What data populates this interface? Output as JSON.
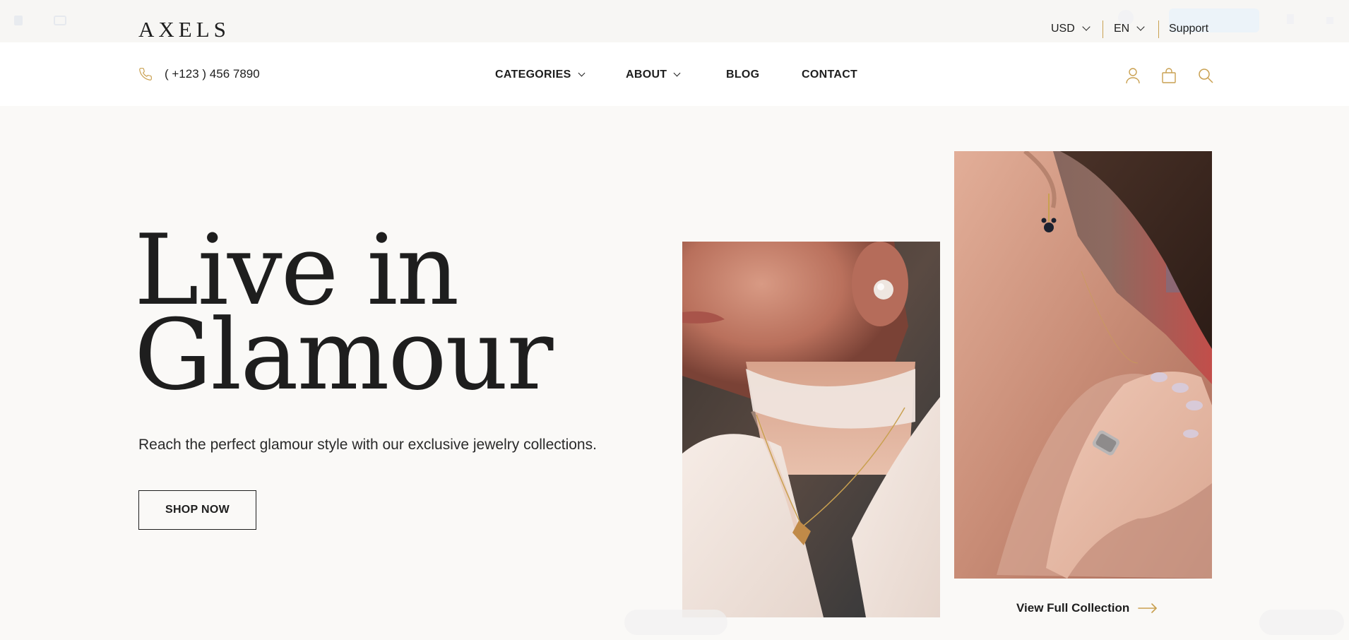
{
  "header": {
    "brand": "AXELS",
    "currency": "USD",
    "language": "EN",
    "support_label": "Support",
    "phone": "( +123 ) 456 7890",
    "nav": [
      {
        "label": "CATEGORIES",
        "has_dropdown": true
      },
      {
        "label": "ABOUT",
        "has_dropdown": true
      },
      {
        "label": "BLOG",
        "has_dropdown": false
      },
      {
        "label": "CONTACT",
        "has_dropdown": false
      }
    ],
    "icons": [
      "user-icon",
      "shopping-bag-icon",
      "search-icon"
    ]
  },
  "hero": {
    "title_line1": "Live in",
    "title_line2": "Glamour",
    "subtitle": "Reach the perfect glamour style with our exclusive jewelry collections.",
    "cta_label": "SHOP NOW"
  },
  "gallery": {
    "view_link_label": "View Full Collection"
  },
  "colors": {
    "accent": "#c9a050",
    "text": "#1e1e1e",
    "background": "#faf9f7",
    "nav_background": "#ffffff"
  }
}
